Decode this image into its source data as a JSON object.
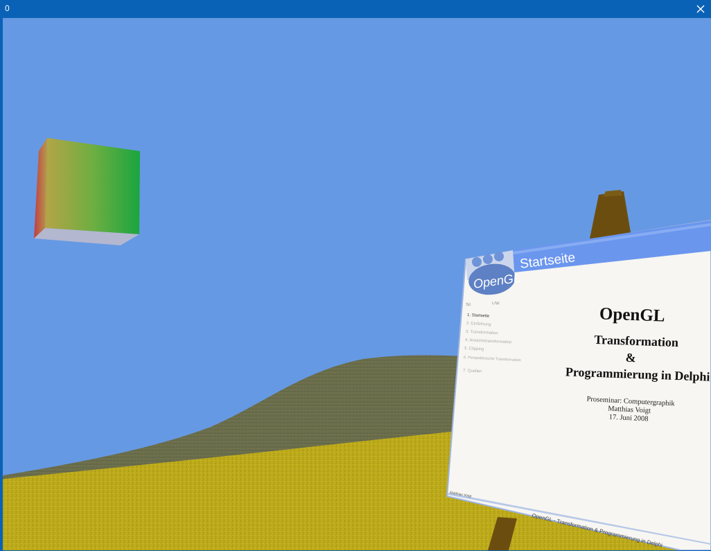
{
  "window": {
    "title": "0"
  },
  "slide": {
    "header": "Startseite",
    "logo": "OpenGL",
    "nav_top_left": "Sit",
    "nav_top_right": "L/W",
    "nav_items": [
      "1. Startseite",
      "2. Einführung",
      "3. Transformation",
      "4. Ansichtstransformation",
      "5. Clipping",
      "6. Perspektivische Transformation",
      "7. Quellen"
    ],
    "title": "OpenGL",
    "subtitle_line1": "Transformation",
    "subtitle_line2": "&",
    "subtitle_line3": "Programmierung in Delphi",
    "info_line1": "Proseminar: Computergraphik",
    "info_line2": "Matthias Voigt",
    "info_line3": "17. Juni 2008",
    "footer_left": "Matthias Voigt",
    "footer_center": "OpenGL - Transformation & Programmierung in Delphi"
  },
  "colors": {
    "titlebar": "#0a62b6",
    "sky": "#6699e3",
    "hill": "#6f7050",
    "ground": "#b8a818",
    "easel": "#6b4e0f",
    "slide_header": "#6b96ee",
    "slide_bg": "#f7f6f2"
  },
  "icons": {
    "close": "close-icon"
  }
}
